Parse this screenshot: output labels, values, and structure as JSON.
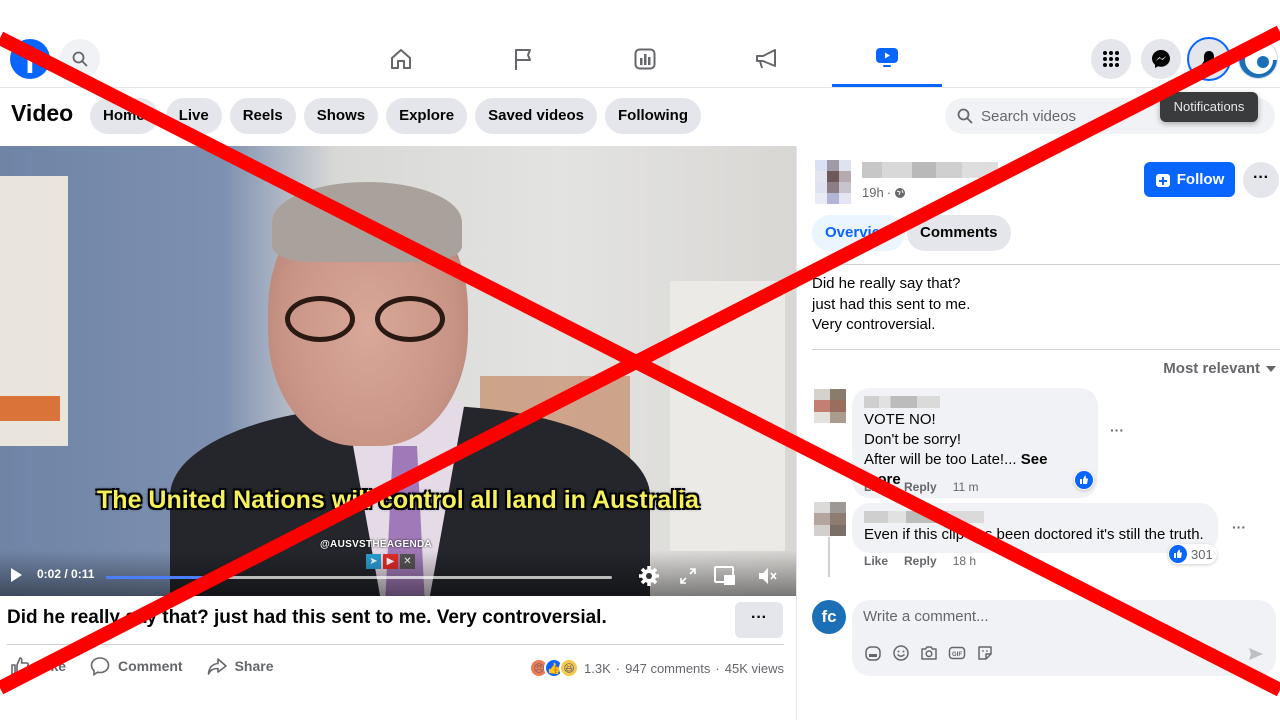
{
  "topbar": {
    "logo": "f",
    "nav_tabs": [
      {
        "name": "home",
        "icon": "home-icon",
        "active": false
      },
      {
        "name": "pages",
        "icon": "flag-icon",
        "active": false
      },
      {
        "name": "ads-manager",
        "icon": "chart-icon",
        "active": false
      },
      {
        "name": "campaigns",
        "icon": "megaphone-icon",
        "active": false
      },
      {
        "name": "video",
        "icon": "video-icon",
        "active": true
      }
    ],
    "right_buttons": [
      "apps-grid-icon",
      "messenger-icon",
      "bell-icon"
    ],
    "tooltip": "Notifications"
  },
  "subheader": {
    "title": "Video",
    "pills": [
      "Home",
      "Live",
      "Reels",
      "Shows",
      "Explore",
      "Saved videos",
      "Following"
    ],
    "search_placeholder": "Search videos"
  },
  "video": {
    "caption": "The United Nations will control all land in Australia",
    "watermark": "@AUSVSTHEAGENDA",
    "current_time": "0:02",
    "duration": "0:11",
    "time_display": "0:02 / 0:11",
    "progress_fraction": 0.2
  },
  "post": {
    "title": "Did he really say that? just had this sent to me. Very controversial.",
    "more_label": "···",
    "actions": [
      "Like",
      "Comment",
      "Share"
    ],
    "reaction_count": "1.3K",
    "comments_count": "947 comments",
    "views": "45K views",
    "separator": "·"
  },
  "sidebar": {
    "author_time": "19h",
    "follow_label": "Follow",
    "more_label": "···",
    "tabs": [
      "Overview",
      "Comments"
    ],
    "description": [
      "Did he really say that?",
      "just had this sent to me.",
      "Very controversial."
    ],
    "sort_label": "Most relevant",
    "comments": [
      {
        "lines": [
          "VOTE NO!",
          "Don't be sorry!"
        ],
        "last_line": "After will be too Late!... ",
        "see_more": "See more",
        "like": "Like",
        "reply": "Reply",
        "time": "11 m",
        "likes": ""
      },
      {
        "lines": [],
        "last_line": "Even if this clip has been doctored it's still the truth.",
        "see_more": "",
        "like": "Like",
        "reply": "Reply",
        "time": "18 h",
        "likes": "301"
      }
    ],
    "composer_placeholder": "Write a comment...",
    "composer_tools": [
      "avatar-sticker-icon",
      "emoji-icon",
      "camera-icon",
      "gif-icon",
      "sticker-icon"
    ],
    "my_avatar": "fc"
  },
  "colors": {
    "brand_blue": "#0866ff",
    "overlay_red": "#ff0000",
    "caption_yellow": "#f6f05a"
  }
}
